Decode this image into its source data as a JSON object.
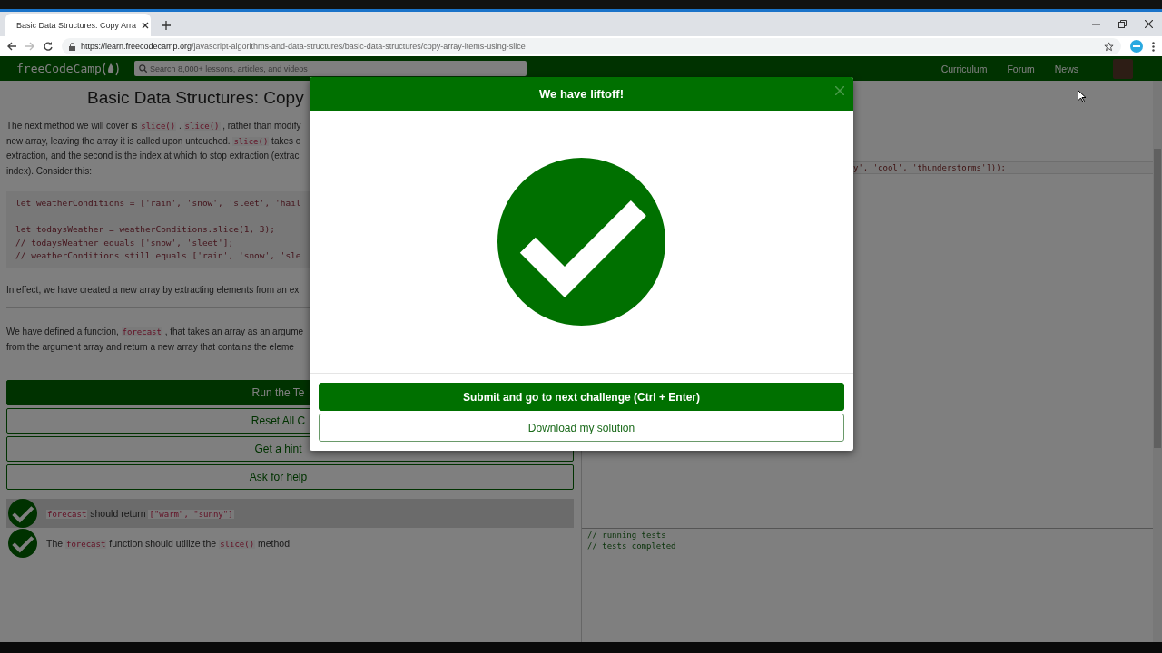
{
  "browser": {
    "tab": {
      "title": "Basic Data Structures: Copy Arra",
      "selected": true
    },
    "url": {
      "domain": "https://learn.freecodecamp.org",
      "path": "/javascript-algorithms-and-data-structures/basic-data-structures/copy-array-items-using-slice"
    }
  },
  "navbar": {
    "logo": "freeCodeCamp",
    "search": {
      "placeholder": "Search 8,000+ lessons, articles, and videos"
    },
    "links": [
      "Curriculum",
      "Forum",
      "News"
    ]
  },
  "lesson": {
    "title": "Basic Data Structures: Copy",
    "intro": [
      [
        {
          "kind": "text",
          "text": "The next method we will cover is "
        },
        {
          "kind": "code",
          "text": "slice()"
        },
        {
          "kind": "text",
          "text": " . "
        },
        {
          "kind": "code",
          "text": "slice()"
        },
        {
          "kind": "text",
          "text": " , rather than modify"
        }
      ],
      [
        {
          "kind": "text",
          "text": "new array, leaving the array it is called upon untouched. "
        },
        {
          "kind": "code",
          "text": "slice()"
        },
        {
          "kind": "text",
          "text": " takes o"
        }
      ],
      [
        {
          "kind": "text",
          "text": "extraction, and the second is the index at which to stop extraction (extrac"
        }
      ],
      [
        {
          "kind": "text",
          "text": "index). Consider this:"
        }
      ]
    ],
    "code_block": [
      [
        "let weatherConditions = ['rain', 'snow', 'sleet', 'hail"
      ],
      [
        "let todaysWeather = weatherConditions.slice(1, 3);",
        "// todaysWeather equals ['snow', 'sleet'];",
        "// weatherConditions still equals ['rain', 'snow', 'sle"
      ]
    ],
    "effect": [
      [
        {
          "kind": "text",
          "text": "In effect, we have created a new array by extracting elements from an ex"
        }
      ]
    ],
    "task": [
      [
        {
          "kind": "text",
          "text": "We have defined a function, "
        },
        {
          "kind": "code",
          "text": "forecast"
        },
        {
          "kind": "text",
          "text": " , that takes an array as an argume"
        }
      ],
      [
        {
          "kind": "text",
          "text": "from the argument array and return a new array that contains the eleme"
        }
      ]
    ],
    "buttons": [
      {
        "label": "Run the Te",
        "kind": "primary"
      },
      {
        "label": "Reset All C",
        "kind": "outline"
      },
      {
        "label": "Get a hint",
        "kind": "outline"
      },
      {
        "label": "Ask for help",
        "kind": "outline"
      }
    ],
    "tests": [
      {
        "passed": true,
        "highlighted": true,
        "segments": [
          {
            "kind": "code",
            "text": "forecast"
          },
          {
            "kind": "text",
            "text": " should return "
          },
          {
            "kind": "code",
            "text": "[\"warm\", \"sunny\"]"
          }
        ]
      },
      {
        "passed": true,
        "highlighted": false,
        "segments": [
          {
            "kind": "text",
            "text": "The "
          },
          {
            "kind": "code",
            "text": "forecast"
          },
          {
            "kind": "text",
            "text": " function should utilize the "
          },
          {
            "kind": "code",
            "text": "slice()"
          },
          {
            "kind": "text",
            "text": " method"
          }
        ]
      }
    ]
  },
  "editor": {
    "lines": [
      "y', 'cool', 'thunderstorms']));"
    ]
  },
  "console": {
    "lines": [
      "// running tests",
      "// tests completed"
    ]
  },
  "modal": {
    "title": "We have liftoff!",
    "buttons": [
      {
        "label": "Submit and go to next challenge (Ctrl + Enter)",
        "kind": "primary"
      },
      {
        "label": "Download my solution",
        "kind": "outline"
      }
    ]
  }
}
